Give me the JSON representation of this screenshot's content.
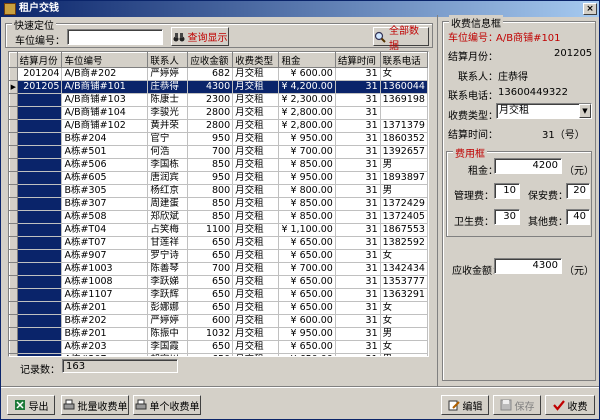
{
  "window": {
    "title": "租户交钱",
    "close": "×"
  },
  "quick": {
    "legend": "快速定位",
    "stall_label": "车位编号：",
    "stall_value": "",
    "query_btn": "查询显示",
    "all_btn": "全部数据"
  },
  "table": {
    "headers": [
      "结算月份",
      "车位编号",
      "联系人",
      "应收金额",
      "收费类型",
      "租金",
      "结算时间",
      "联系电话"
    ],
    "rows": [
      [
        "201204",
        "A/B商#202",
        "严婷婷",
        "682",
        "月交租",
        "¥ 600.00",
        "31",
        "女"
      ],
      [
        "201205",
        "A/B商铺#101",
        "庄恭得",
        "4300",
        "月交租",
        "¥ 4,200.00",
        "31",
        "1360044"
      ],
      [
        "",
        "A/B商铺#103",
        "陈康士",
        "2300",
        "月交租",
        "¥ 2,300.00",
        "31",
        "1369198"
      ],
      [
        "",
        "A/B商铺#104",
        "李骏光",
        "2800",
        "月交租",
        "¥ 2,800.00",
        "31",
        ""
      ],
      [
        "",
        "A/B商铺#102",
        "黄并荣",
        "2800",
        "月交租",
        "¥ 2,800.00",
        "31",
        "1371379"
      ],
      [
        "",
        "B栋#204",
        "官宁",
        "950",
        "月交租",
        "¥ 950.00",
        "31",
        "1860352"
      ],
      [
        "",
        "A栋#501",
        "何浩",
        "700",
        "月交租",
        "¥ 700.00",
        "31",
        "1392657"
      ],
      [
        "",
        "A栋#506",
        "李国栋",
        "850",
        "月交租",
        "¥ 850.00",
        "31",
        "男"
      ],
      [
        "",
        "A栋#605",
        "唐润宾",
        "950",
        "月交租",
        "¥ 950.00",
        "31",
        "1893897"
      ],
      [
        "",
        "B栋#305",
        "杨红京",
        "800",
        "月交租",
        "¥ 800.00",
        "31",
        "男"
      ],
      [
        "",
        "B栋#307",
        "周建蛋",
        "850",
        "月交租",
        "¥ 850.00",
        "31",
        "1372429"
      ],
      [
        "",
        "A栋#508",
        "郑欣斌",
        "850",
        "月交租",
        "¥ 850.00",
        "31",
        "1372405"
      ],
      [
        "",
        "A栋#T04",
        "占笑梅",
        "1100",
        "月交租",
        "¥ 1,100.00",
        "31",
        "1867553"
      ],
      [
        "",
        "A栋#T07",
        "甘莲祥",
        "650",
        "月交租",
        "¥ 650.00",
        "31",
        "1382592"
      ],
      [
        "",
        "A栋#907",
        "罗宁诗",
        "650",
        "月交租",
        "¥ 650.00",
        "31",
        "女"
      ],
      [
        "",
        "A栋#1003",
        "陈善琴",
        "700",
        "月交租",
        "¥ 700.00",
        "31",
        "1342434"
      ],
      [
        "",
        "A栋#1008",
        "李跃娣",
        "650",
        "月交租",
        "¥ 650.00",
        "31",
        "1353777"
      ],
      [
        "",
        "A栋#1107",
        "李跃辉",
        "650",
        "月交租",
        "¥ 650.00",
        "31",
        "1363291"
      ],
      [
        "",
        "A栋#201",
        "彭娜娜",
        "650",
        "月交租",
        "¥ 650.00",
        "31",
        "女"
      ],
      [
        "",
        "B栋#202",
        "严婷婷",
        "600",
        "月交租",
        "¥ 600.00",
        "31",
        "女"
      ],
      [
        "",
        "B栋#201",
        "陈振中",
        "1032",
        "月交租",
        "¥ 950.00",
        "31",
        "男"
      ],
      [
        "",
        "A栋#203",
        "李国霞",
        "650",
        "月交租",
        "¥ 650.00",
        "31",
        "女"
      ],
      [
        "",
        "A栋#207",
        "胡定川",
        "650",
        "月交租",
        "¥ 650.00",
        "31",
        "男"
      ],
      [
        "",
        "A栋#201",
        "霍娃秀",
        "650",
        "月交租",
        "¥ 650.00",
        "31",
        "女"
      ],
      [
        "",
        "A栋#205",
        "衡广鹏",
        "940",
        "月交租",
        "¥ 950.00",
        "31",
        "男"
      ]
    ]
  },
  "status": {
    "count_label": "记录数：",
    "count_value": "163"
  },
  "bottom": {
    "export": "导出",
    "batch": "批量收费单",
    "single": "单个收费单",
    "edit": "编辑",
    "save": "保存",
    "collect": "收费"
  },
  "info": {
    "legend": "收费信息框",
    "stall_label": "车位编号：",
    "stall_value": "A/B商铺#101",
    "month_label": "结算月份：",
    "month_value": "201205",
    "contact_label": "联系人：",
    "contact_value": "庄恭得",
    "phone_label": "联系电话：",
    "phone_value": "13600449322",
    "type_label": "收费类型：",
    "type_value": "月交租",
    "settle_label": "结算时间：",
    "settle_value": "31（号）"
  },
  "fee": {
    "legend": "费用框",
    "rent_label": "租金：",
    "rent_value": "4200",
    "rent_unit": "（元）",
    "mgmt_label": "管理费：",
    "mgmt_value": "10",
    "security_label": "保安费：",
    "security_value": "20",
    "hygiene_label": "卫生费：",
    "hygiene_value": "30",
    "other_label": "其他费：",
    "other_value": "40",
    "due_label": "应收金额：",
    "due_value": "4300",
    "due_unit": "（元）"
  }
}
